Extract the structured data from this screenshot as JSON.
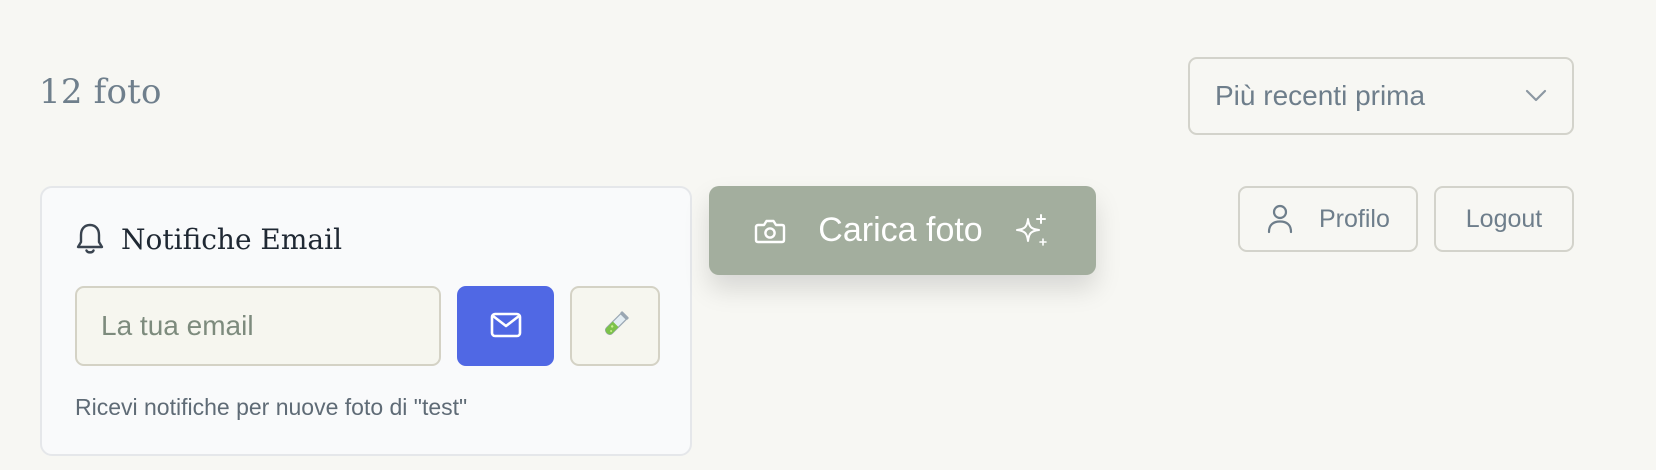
{
  "header": {
    "photo_count": "12 foto"
  },
  "sort": {
    "selected": "Più recenti prima",
    "icon": "chevron-down-icon"
  },
  "notifications": {
    "title": "Notifiche Email",
    "title_icon": "bell-icon",
    "email_placeholder": "La tua email",
    "email_value": "",
    "send_icon": "mail-icon",
    "test_icon": "test-tube-icon",
    "help_text": "Ricevi notifiche per nuove foto di \"test\""
  },
  "upload": {
    "label": "Carica foto",
    "left_icon": "camera-icon",
    "right_icon": "sparkle-icon"
  },
  "nav": {
    "profile_label": "Profilo",
    "profile_icon": "user-icon",
    "logout_label": "Logout"
  },
  "colors": {
    "background": "#f7f7f3",
    "accent_blue": "#5068e4",
    "upload_green": "#a3ae9e",
    "muted_text": "#6e7e8b"
  }
}
